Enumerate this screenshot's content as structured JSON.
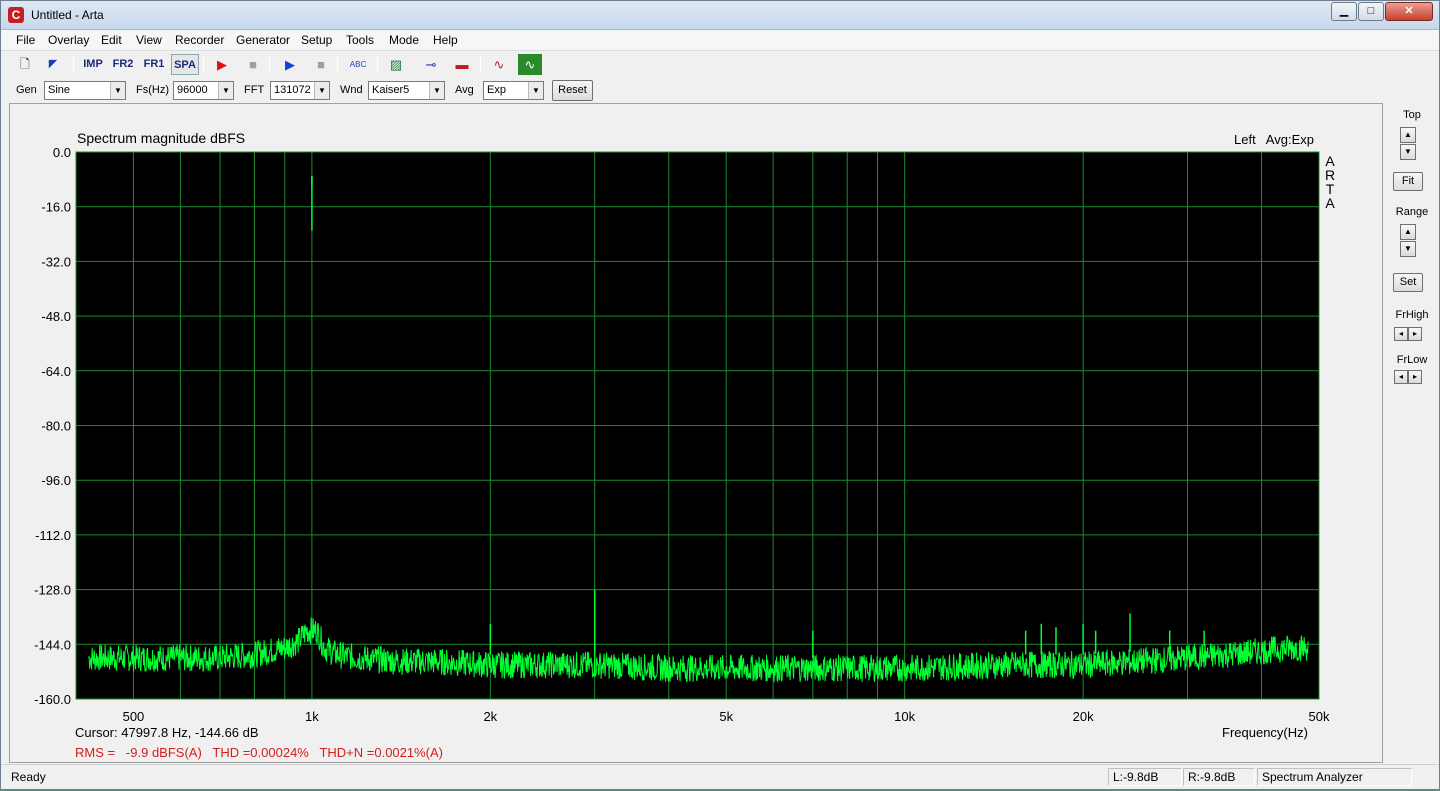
{
  "window": {
    "title": "Untitled - Arta",
    "app_icon": "C",
    "controls": {
      "minimize": "▁",
      "maximize": "□",
      "close": "✕"
    }
  },
  "menu": [
    "File",
    "Overlay",
    "Edit",
    "View",
    "Recorder",
    "Generator",
    "Setup",
    "Tools",
    "Mode",
    "Help"
  ],
  "toolbar": {
    "items": [
      {
        "name": "new-doc-icon",
        "glyph": "🗋"
      },
      {
        "name": "open-icon",
        "glyph": "◤"
      },
      {
        "name": "imp-mode-button",
        "glyph": "IMP"
      },
      {
        "name": "fr2-mode-button",
        "glyph": "FR2"
      },
      {
        "name": "fr1-mode-button",
        "glyph": "FR1"
      },
      {
        "name": "spa-mode-button",
        "glyph": "SPA"
      },
      {
        "name": "record-play-red-icon",
        "glyph": "▶"
      },
      {
        "name": "stop-icon",
        "glyph": "■"
      },
      {
        "name": "play-blue-icon",
        "glyph": "▶"
      },
      {
        "name": "stop2-icon",
        "glyph": "■"
      },
      {
        "name": "abc-icon",
        "glyph": "ABC"
      },
      {
        "name": "hatch-icon",
        "glyph": "▨"
      },
      {
        "name": "probe-icon",
        "glyph": "⊸"
      },
      {
        "name": "level-icon",
        "glyph": "▬"
      },
      {
        "name": "sine-red-icon",
        "glyph": "∿"
      },
      {
        "name": "sine-green-icon",
        "glyph": "∿"
      }
    ]
  },
  "params": {
    "gen_label": "Gen",
    "gen_value": "Sine",
    "fs_label": "Fs(Hz)",
    "fs_value": "96000",
    "fft_label": "FFT",
    "fft_value": "131072",
    "wnd_label": "Wnd",
    "wnd_value": "Kaiser5",
    "avg_label": "Avg",
    "avg_value": "Exp",
    "reset_label": "Reset"
  },
  "plot": {
    "title": "Spectrum magnitude dBFS",
    "right_title": "Left   Avg:Exp",
    "watermark": [
      "A",
      "R",
      "T",
      "A"
    ],
    "x_axis_title": "Frequency(Hz)",
    "cursor_text": "Cursor: 47997.8 Hz, -144.66 dB",
    "rms_text": "RMS =   -9.9 dBFS(A)   THD =0.00024%   THD+N =0.0021%(A)"
  },
  "side_panel": {
    "top_label": "Top",
    "fit_label": "Fit",
    "range_label": "Range",
    "set_label": "Set",
    "frhigh_label": "FrHigh",
    "frlow_label": "FrLow"
  },
  "status": {
    "left": "Ready",
    "l_level": "L:-9.8dB",
    "r_level": "R:-9.8dB",
    "mode": "Spectrum Analyzer"
  },
  "colors": {
    "plot_bg": "#000000",
    "grid": "#1e8c2d",
    "trace": "#00ff33",
    "rms_text": "#d21e1e"
  },
  "chart_data": {
    "type": "line",
    "title": "Spectrum magnitude dBFS",
    "xlabel": "Frequency(Hz)",
    "ylabel": "",
    "x_scale": "log",
    "xlim": [
      400,
      50000
    ],
    "ylim": [
      -160,
      0
    ],
    "y_ticks": [
      0,
      -16,
      -32,
      -48,
      -64,
      -80,
      -96,
      -112,
      -128,
      -144,
      -160
    ],
    "y_tick_labels": [
      "0.0",
      "-16.0",
      "-32.0",
      "-48.0",
      "-64.0",
      "-80.0",
      "-96.0",
      "-112.0",
      "-128.0",
      "-144.0",
      "-160.0"
    ],
    "x_tick_values": [
      500,
      1000,
      2000,
      5000,
      10000,
      20000,
      50000
    ],
    "x_tick_labels": [
      "500",
      "1k",
      "2k",
      "5k",
      "10k",
      "20k",
      "50k"
    ],
    "grid": true,
    "series": [
      {
        "name": "Left",
        "x": [
          420,
          500,
          600,
          700,
          800,
          900,
          950,
          980,
          1000,
          1020,
          1050,
          1100,
          1200,
          1400,
          1600,
          2000,
          2500,
          3000,
          4000,
          5000,
          7000,
          10000,
          15000,
          20000,
          25000,
          30000,
          35000,
          40000,
          45000,
          48000
        ],
        "y": [
          -148,
          -148,
          -148,
          -148,
          -147,
          -145,
          -143,
          -140,
          -10,
          -140,
          -145,
          -147,
          -148,
          -149,
          -149,
          -150,
          -150,
          -150,
          -151,
          -151,
          -151,
          -151,
          -150,
          -150,
          -149,
          -148,
          -147,
          -146,
          -145,
          -145
        ]
      }
    ],
    "harmonic_spikes": [
      {
        "x": 1000,
        "y": -10
      },
      {
        "x": 1000,
        "y": -23
      },
      {
        "x": 2000,
        "y": -138
      },
      {
        "x": 3000,
        "y": -128
      },
      {
        "x": 7000,
        "y": -140
      },
      {
        "x": 16000,
        "y": -140
      },
      {
        "x": 17000,
        "y": -138
      },
      {
        "x": 18000,
        "y": -139
      },
      {
        "x": 20000,
        "y": -138
      },
      {
        "x": 21000,
        "y": -140
      },
      {
        "x": 24000,
        "y": -135
      },
      {
        "x": 28000,
        "y": -140
      },
      {
        "x": 32000,
        "y": -140
      }
    ]
  }
}
